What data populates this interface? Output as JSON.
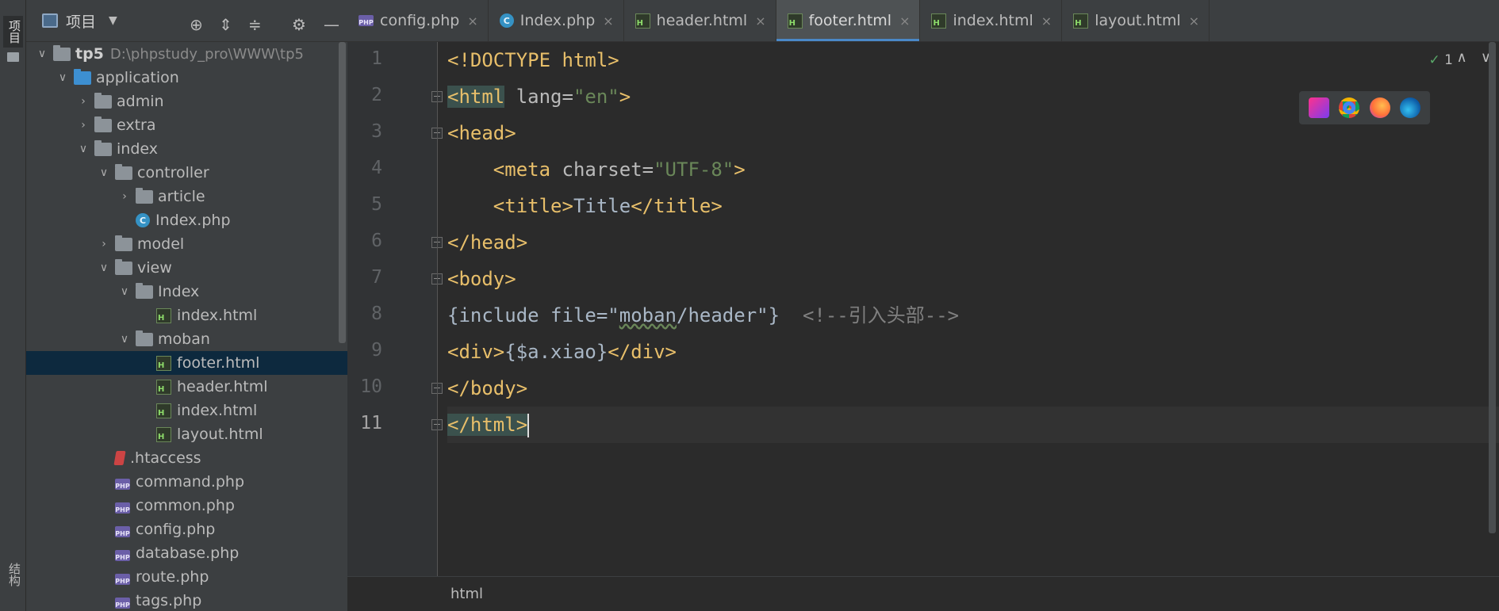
{
  "toolstrip": {
    "project_tab": "项目",
    "structure_tab": "结构"
  },
  "project_panel": {
    "title": "项目",
    "tree": [
      {
        "label": "tp5",
        "path": "D:\\phpstudy_pro\\WWW\\tp5",
        "type": "root",
        "depth": 0,
        "expanded": true
      },
      {
        "label": "application",
        "type": "folder-blue",
        "depth": 1,
        "expanded": true
      },
      {
        "label": "admin",
        "type": "folder",
        "depth": 2,
        "expanded": false
      },
      {
        "label": "extra",
        "type": "folder",
        "depth": 2,
        "expanded": false
      },
      {
        "label": "index",
        "type": "folder",
        "depth": 2,
        "expanded": true
      },
      {
        "label": "controller",
        "type": "folder",
        "depth": 3,
        "expanded": true
      },
      {
        "label": "article",
        "type": "folder",
        "depth": 4,
        "expanded": false
      },
      {
        "label": "Index.php",
        "type": "class",
        "depth": 4
      },
      {
        "label": "model",
        "type": "folder",
        "depth": 3,
        "expanded": false
      },
      {
        "label": "view",
        "type": "folder",
        "depth": 3,
        "expanded": true
      },
      {
        "label": "Index",
        "type": "folder",
        "depth": 4,
        "expanded": true
      },
      {
        "label": "index.html",
        "type": "html",
        "depth": 5
      },
      {
        "label": "moban",
        "type": "folder",
        "depth": 4,
        "expanded": true
      },
      {
        "label": "footer.html",
        "type": "html",
        "depth": 5,
        "selected": true
      },
      {
        "label": "header.html",
        "type": "html",
        "depth": 5
      },
      {
        "label": "index.html",
        "type": "html",
        "depth": 5
      },
      {
        "label": "layout.html",
        "type": "html",
        "depth": 5
      },
      {
        "label": ".htaccess",
        "type": "htaccess",
        "depth": 3
      },
      {
        "label": "command.php",
        "type": "php",
        "depth": 3
      },
      {
        "label": "common.php",
        "type": "php",
        "depth": 3
      },
      {
        "label": "config.php",
        "type": "php",
        "depth": 3
      },
      {
        "label": "database.php",
        "type": "php",
        "depth": 3
      },
      {
        "label": "route.php",
        "type": "php",
        "depth": 3
      },
      {
        "label": "tags.php",
        "type": "php",
        "depth": 3
      }
    ]
  },
  "tabs": [
    {
      "label": "config.php",
      "type": "php",
      "active": false
    },
    {
      "label": "Index.php",
      "type": "class",
      "active": false
    },
    {
      "label": "header.html",
      "type": "html",
      "active": false
    },
    {
      "label": "footer.html",
      "type": "html",
      "active": true
    },
    {
      "label": "index.html",
      "type": "html",
      "active": false
    },
    {
      "label": "layout.html",
      "type": "html",
      "active": false
    }
  ],
  "editor": {
    "line_numbers": [
      "1",
      "2",
      "3",
      "4",
      "5",
      "6",
      "7",
      "8",
      "9",
      "10",
      "11"
    ],
    "current_line": 11,
    "inspection_count": "1",
    "breadcrumb": "html",
    "code": {
      "l1": "<!DOCTYPE html>",
      "l2_tag_open": "<html",
      "l2_attr": " lang=",
      "l2_val": "\"en\"",
      "l2_close": ">",
      "l3": "<head>",
      "l4_open": "<meta",
      "l4_attr": " charset=",
      "l4_val": "\"UTF-8\"",
      "l4_close": ">",
      "l5_open": "<title>",
      "l5_text": "Title",
      "l5_close": "</title>",
      "l6": "</head>",
      "l7": "<body>",
      "l8_pre": "{include file=\"",
      "l8_moban": "moban",
      "l8_post": "/header\"}",
      "l8_comment": "<!--引入头部-->",
      "l9_open": "<div>",
      "l9_text": "{$a.xiao}",
      "l9_close": "</div>",
      "l10": "</body>",
      "l11": "</html>"
    }
  },
  "colors": {
    "accent": "#4a88c7",
    "tag": "#e8bf6a",
    "string": "#6a8759",
    "comment": "#808080",
    "selection": "#0d293e"
  }
}
